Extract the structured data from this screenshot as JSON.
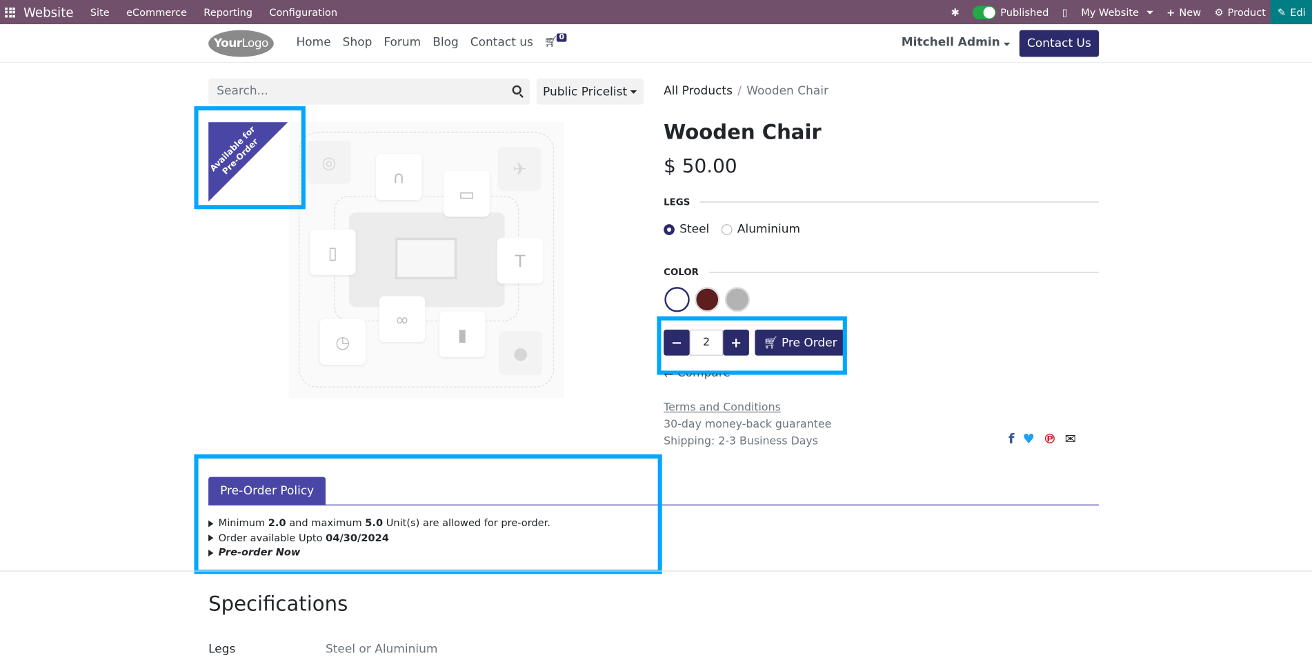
{
  "admin_bar": {
    "brand": "Website",
    "menus": [
      "Site",
      "eCommerce",
      "Reporting",
      "Configuration"
    ],
    "published_label": "Published",
    "my_website_label": "My Website",
    "new_label": "New",
    "product_label": "Product",
    "edit_label": "Edi"
  },
  "header": {
    "logo_bold": "Your",
    "logo_light": "Logo",
    "nav": [
      "Home",
      "Shop",
      "Forum",
      "Blog",
      "Contact us"
    ],
    "cart_count": "0",
    "user": "Mitchell Admin",
    "contact_button": "Contact Us"
  },
  "search": {
    "placeholder": "Search...",
    "pricelist": "Public Pricelist"
  },
  "ribbon": {
    "line1": "Available for",
    "line2": "Pre-Order"
  },
  "breadcrumb": {
    "parent": "All Products",
    "sep": "/",
    "current": "Wooden Chair"
  },
  "product": {
    "title": "Wooden Chair",
    "price": "$ 50.00",
    "legs_label": "LEGS",
    "legs_options": [
      "Steel",
      "Aluminium"
    ],
    "color_label": "COLOR",
    "colors": [
      "#ffffff",
      "#5c1e1e",
      "#b3b3b3"
    ],
    "quantity": "2",
    "minus": "−",
    "plus": "+",
    "preorder_label": "Pre Order",
    "compare_label": "Compare",
    "terms_link": "Terms and Conditions",
    "guarantee": "30-day money-back guarantee",
    "shipping": "Shipping: 2-3 Business Days"
  },
  "policy": {
    "tab_label": "Pre-Order Policy",
    "line1_a": "Minimum ",
    "line1_min": "2.0",
    "line1_b": " and maximum ",
    "line1_max": "5.0",
    "line1_c": " Unit(s) are allowed for pre-order.",
    "line2_a": "Order available Upto ",
    "line2_date": "04/30/2024",
    "line3": "Pre-order Now"
  },
  "specifications": {
    "title": "Specifications",
    "rows": [
      {
        "key": "Legs",
        "value": "Steel or Aluminium"
      }
    ]
  },
  "colors": {
    "admin_bar": "#71506b",
    "primary": "#2b2b6b",
    "ribbon": "#4a46a6",
    "highlight": "#00a7ff"
  }
}
